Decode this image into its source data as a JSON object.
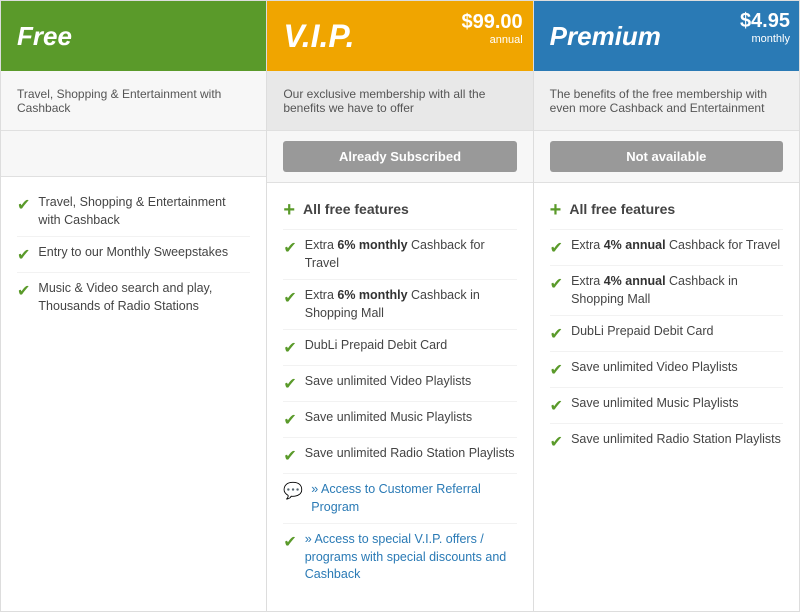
{
  "columns": {
    "free": {
      "title": "Free",
      "subtitle": "Travel, Shopping & Entertainment with Cashback",
      "features": [
        {
          "type": "check",
          "text": "Travel, Shopping & Entertainment with Cashback"
        },
        {
          "type": "check",
          "text": "Entry to our Monthly Sweepstakes"
        },
        {
          "type": "check",
          "text": "Music & Video search and play, Thousands of Radio Stations"
        }
      ]
    },
    "vip": {
      "title": "V.I.P.",
      "price": "$99.00",
      "period": "annual",
      "subtitle": "Our exclusive membership with all the benefits we have to offer",
      "action_label": "Already Subscribed",
      "all_free_label": "All free features",
      "features": [
        {
          "type": "check",
          "html": "Extra <strong>6% monthly</strong> Cashback for Travel"
        },
        {
          "type": "check",
          "html": "Extra <strong>6% monthly</strong> Cashback in Shopping Mall"
        },
        {
          "type": "check",
          "text": "DubLi Prepaid Debit Card"
        },
        {
          "type": "check",
          "text": "Save unlimited Video Playlists"
        },
        {
          "type": "check",
          "text": "Save unlimited Music Playlists"
        },
        {
          "type": "check",
          "text": "Save unlimited Radio Station Playlists"
        },
        {
          "type": "chat",
          "link": "» Access to Customer Referral Program"
        },
        {
          "type": "check",
          "link": "» Access to special V.I.P. offers / programs with special discounts and Cashback"
        }
      ]
    },
    "premium": {
      "title": "Premium",
      "price": "$4.95",
      "period": "monthly",
      "subtitle": "The benefits of the free membership with even more Cashback and Entertainment",
      "action_label": "Not available",
      "all_free_label": "All free features",
      "features": [
        {
          "type": "check",
          "html": "Extra <strong>4% annual</strong> Cashback for Travel"
        },
        {
          "type": "check",
          "html": "Extra <strong>4% annual</strong> Cashback in Shopping Mall"
        },
        {
          "type": "check",
          "text": "DubLi Prepaid Debit Card"
        },
        {
          "type": "check",
          "text": "Save unlimited Video Playlists"
        },
        {
          "type": "check",
          "text": "Save unlimited Music Playlists"
        },
        {
          "type": "check",
          "text": "Save unlimited Radio Station Playlists"
        }
      ]
    }
  }
}
